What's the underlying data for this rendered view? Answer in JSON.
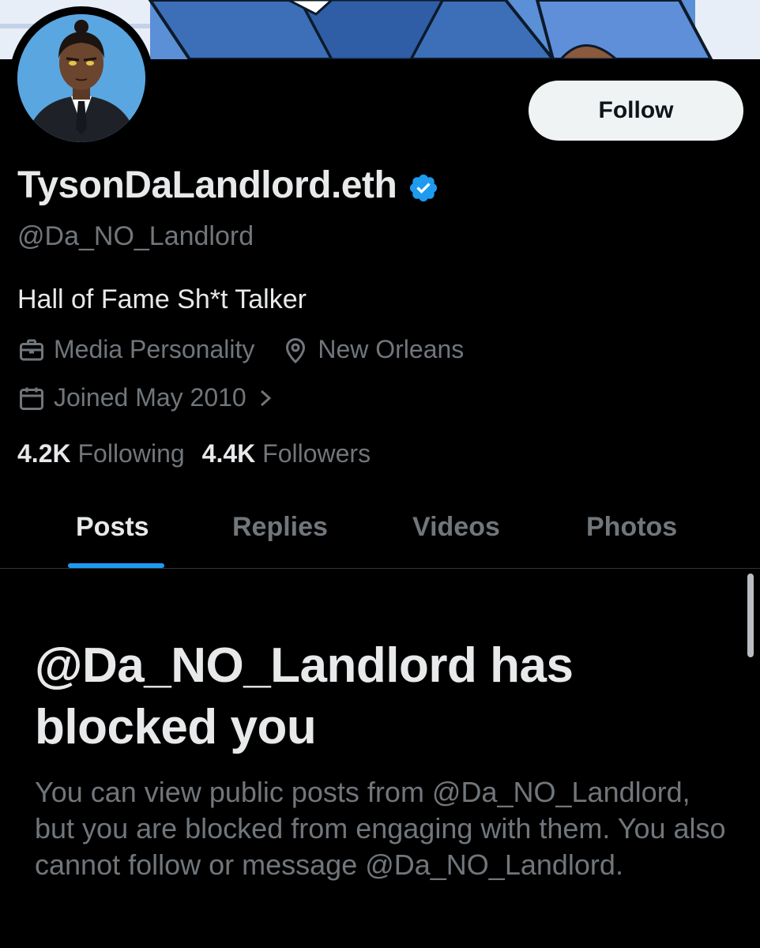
{
  "profile": {
    "display_name": "TysonDaLandlord.eth",
    "handle": "@Da_NO_Landlord",
    "bio": "Hall of Fame Sh*t Talker",
    "category": "Media Personality",
    "location": "New Orleans",
    "joined": "Joined May 2010",
    "following_count": "4.2K",
    "following_label": "Following",
    "followers_count": "4.4K",
    "followers_label": "Followers"
  },
  "actions": {
    "follow_label": "Follow"
  },
  "tabs": [
    {
      "label": "Posts",
      "active": true
    },
    {
      "label": "Replies",
      "active": false
    },
    {
      "label": "Videos",
      "active": false
    },
    {
      "label": "Photos",
      "active": false
    }
  ],
  "blocked": {
    "title": "@Da_NO_Landlord has blocked you",
    "description": "You can view public posts from @Da_NO_Landlord, but you are blocked from engaging with them. You also cannot follow or message @Da_NO_Landlord."
  },
  "icons": {
    "verified": "verified-badge-icon",
    "category": "briefcase-icon",
    "location": "location-pin-icon",
    "joined": "calendar-icon",
    "chevron": "chevron-right-icon"
  },
  "colors": {
    "background": "#000000",
    "accent": "#1d9bf0",
    "text_primary": "#e7e9ea",
    "text_secondary": "#71767b",
    "button_bg": "#eff3f4"
  }
}
